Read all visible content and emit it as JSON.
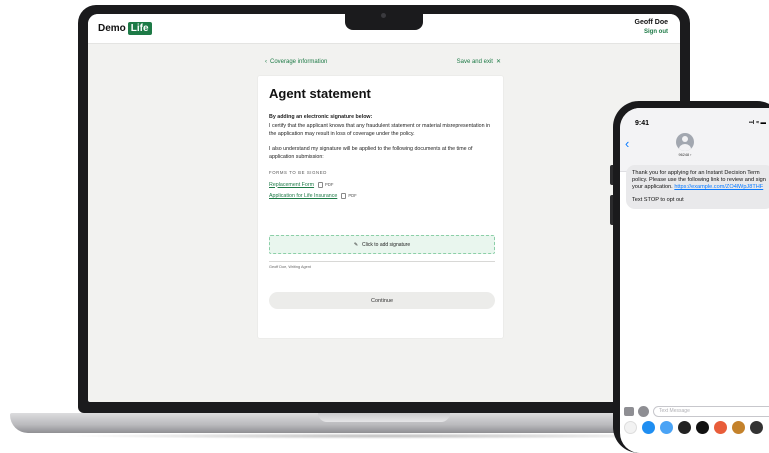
{
  "laptop": {
    "brand": {
      "name": "Demo",
      "badge": "Life"
    },
    "user": {
      "name": "Geoff Doe",
      "sign_out": "Sign out"
    },
    "subnav": {
      "back_label": "Coverage information",
      "save_exit_label": "Save and exit"
    },
    "card": {
      "title": "Agent statement",
      "intro_heading": "By adding an electronic signature below:",
      "certify_text": "I certify that the applicant knows that any fraudulent statement or material misrepresentation in the application may result in loss of coverage under the policy.",
      "understand_text": "I also understand my signature will be applied to the following documents at the time of application submission:",
      "forms_label": "FORMS TO BE SIGNED",
      "forms": [
        {
          "name": "Replacement Form",
          "type": "PDF"
        },
        {
          "name": "Application for Life Insurance",
          "type": "PDF"
        }
      ],
      "signature_button": "Click to add signature",
      "signature_caption": "Geoff Doe, Writing Agent",
      "continue_label": "Continue"
    }
  },
  "phone": {
    "time": "9:41",
    "contact_number": "96248",
    "message": {
      "text": "Thank you for applying for an Instant Decision Term policy. Please use the following link to review and sign your application.",
      "link": "https://example.com/ZO4lWpJ8THF",
      "opt_out": "Text STOP to opt out"
    },
    "compose_placeholder": "Text Message"
  },
  "colors": {
    "brand_green": "#1d7a46",
    "signature_bg": "#e9f6ee",
    "ios_blue": "#0a7aff"
  }
}
